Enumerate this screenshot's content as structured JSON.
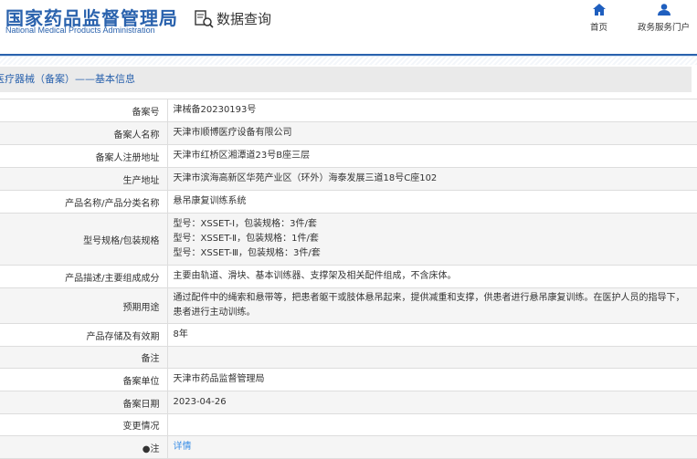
{
  "header": {
    "logo_cn": "国家药品监督管理局",
    "logo_en": "National Medical Products Administration",
    "query_label": "数据查询",
    "nav": [
      {
        "label": "首页",
        "icon": "home-icon"
      },
      {
        "label": "政务服务门户",
        "icon": "user-icon"
      }
    ]
  },
  "section_title": "医疗器械（备案）——基本信息",
  "rows": [
    {
      "label": "备案号",
      "value": "津械备20230193号"
    },
    {
      "label": "备案人名称",
      "value": "天津市顺博医疗设备有限公司"
    },
    {
      "label": "备案人注册地址",
      "value": "天津市红桥区湘潭道23号B座三层"
    },
    {
      "label": "生产地址",
      "value": "天津市滨海高新区华苑产业区（环外）海泰发展三道18号C座102"
    },
    {
      "label": "产品名称/产品分类名称",
      "value": "悬吊康复训练系统"
    },
    {
      "label": "型号规格/包装规格",
      "lines": [
        "型号：XSSET-Ⅰ，包装规格：3件/套",
        "型号：XSSET-Ⅱ，包装规格：1件/套",
        "型号：XSSET-Ⅲ，包装规格：3件/套"
      ]
    },
    {
      "label": "产品描述/主要组成成分",
      "value": "主要由轨道、滑块、基本训练器、支撑架及相关配件组成，不含床体。"
    },
    {
      "label": "预期用途",
      "value": "通过配件中的绳索和悬带等，把患者躯干或肢体悬吊起来，提供减重和支撑，供患者进行悬吊康复训练。在医护人员的指导下，患者进行主动训练。"
    },
    {
      "label": "产品存储及有效期",
      "value": "8年"
    },
    {
      "label": "备注",
      "value": ""
    },
    {
      "label": "备案单位",
      "value": "天津市药品监督管理局"
    },
    {
      "label": "备案日期",
      "value": "2023-04-26"
    },
    {
      "label": "变更情况",
      "value": ""
    },
    {
      "label": "●注",
      "value": "详情"
    }
  ]
}
